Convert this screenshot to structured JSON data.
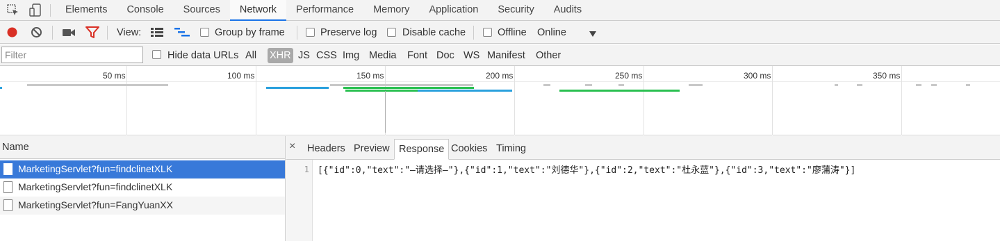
{
  "tabs": [
    "Elements",
    "Console",
    "Sources",
    "Network",
    "Performance",
    "Memory",
    "Application",
    "Security",
    "Audits"
  ],
  "active_tab": "Network",
  "toolbar": {
    "view_label": "View:",
    "group_by_frame": "Group by frame",
    "preserve_log": "Preserve log",
    "disable_cache": "Disable cache",
    "offline": "Offline",
    "throttling": "Online",
    "colors": {
      "record": "#d93025",
      "filter": "#d93025",
      "accent": "#1a73e8"
    }
  },
  "filter": {
    "placeholder": "Filter",
    "hide_data_urls": "Hide data URLs",
    "types": [
      "All",
      "XHR",
      "JS",
      "CSS",
      "Img",
      "Media",
      "Font",
      "Doc",
      "WS",
      "Manifest",
      "Other"
    ],
    "active_type": "XHR"
  },
  "overview": {
    "ticks": [
      "50 ms",
      "100 ms",
      "150 ms",
      "200 ms",
      "250 ms",
      "300 ms",
      "350 ms"
    ]
  },
  "requests": {
    "header": "Name",
    "rows": [
      "MarketingServlet?fun=findclinetXLK",
      "MarketingServlet?fun=findclinetXLK",
      "MarketingServlet?fun=FangYuanXX"
    ]
  },
  "detail": {
    "close": "×",
    "tabs": [
      "Headers",
      "Preview",
      "Response",
      "Cookies",
      "Timing"
    ],
    "active_tab": "Response",
    "line_number": "1",
    "response": "[{\"id\":0,\"text\":\"—请选择—\"},{\"id\":1,\"text\":\"刘德华\"},{\"id\":2,\"text\":\"杜永蓝\"},{\"id\":3,\"text\":\"廖蒲涛\"}]"
  }
}
